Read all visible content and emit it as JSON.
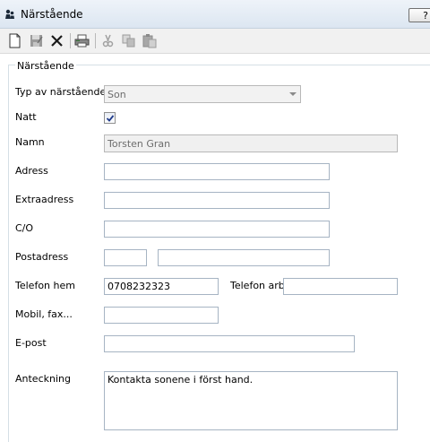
{
  "window": {
    "title": "Närstående",
    "help_label": "?"
  },
  "toolbar": {
    "buttons": [
      {
        "icon": "new-document-icon",
        "enabled": true
      },
      {
        "icon": "save-icon",
        "enabled": false
      },
      {
        "icon": "delete-icon",
        "enabled": true
      },
      {
        "icon": "print-icon",
        "enabled": true
      },
      {
        "icon": "cut-icon",
        "enabled": false
      },
      {
        "icon": "copy-icon",
        "enabled": false
      },
      {
        "icon": "paste-icon",
        "enabled": false
      }
    ]
  },
  "form": {
    "group_title": "Närstående",
    "relation_type": {
      "label": "Typ av närstående",
      "value": "Son"
    },
    "night": {
      "label": "Natt",
      "checked": true
    },
    "name": {
      "label": "Namn",
      "value": "Torsten Gran"
    },
    "address": {
      "label": "Adress",
      "value": ""
    },
    "extra_address": {
      "label": "Extraadress",
      "value": ""
    },
    "co": {
      "label": "C/O",
      "value": ""
    },
    "postal_address": {
      "label": "Postadress",
      "zip": "",
      "city": ""
    },
    "phone_home": {
      "label": "Telefon hem",
      "value": "0708232323"
    },
    "phone_work": {
      "label": "Telefon arb",
      "value": ""
    },
    "mobile_fax": {
      "label": "Mobil, fax...",
      "value": ""
    },
    "email": {
      "label": "E-post",
      "value": ""
    },
    "note": {
      "label": "Anteckning",
      "value": "Kontakta sonene i först hand."
    }
  },
  "colors": {
    "title_bar": "#dce6f1",
    "field_border": "#a6b4c3",
    "readonly_bg": "#f0f0f0"
  }
}
